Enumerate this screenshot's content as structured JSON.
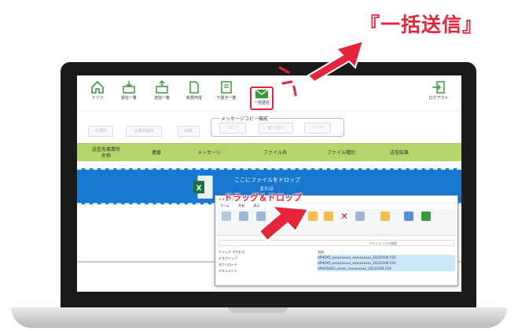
{
  "callout_title": "『一括送信』",
  "toolbar": {
    "items": [
      {
        "label": "ドリフ",
        "icon": "home-icon"
      },
      {
        "label": "受信一覧",
        "icon": "inbox-icon"
      },
      {
        "label": "送信一覧",
        "icon": "outbox-icon"
      },
      {
        "label": "新規作成",
        "icon": "new-document-icon"
      },
      {
        "label": "下書き一覧",
        "icon": "drafts-icon"
      },
      {
        "label": "一括送信",
        "icon": "bulk-send-icon"
      },
      {
        "label": "ログアウト",
        "icon": "logout-icon"
      }
    ]
  },
  "actions": {
    "select_all": "全選択",
    "deselect_all": "全選択解除",
    "delete": "削除"
  },
  "copy_group": {
    "title": "メッセージコピー機能",
    "copy": "コピー",
    "paste": "貼り付け",
    "clear": "クリア"
  },
  "table": {
    "headers": [
      "送信先事業所\n名称",
      "連番",
      "メッセージ",
      "ファイル名",
      "ファイル種別",
      "送信結果"
    ]
  },
  "dropzone": {
    "line1": "ここにファイルをドロップ",
    "line2": "または"
  },
  "drag_drop_label": "ドラッグ＆ドロップ",
  "explorer": {
    "title": "ドキュメント",
    "tabs": [
      "ホーム",
      "共有",
      "表示"
    ],
    "sidebar": [
      "クイック アクセス",
      "デスクトップ",
      "ダウンロード",
      "ドキュメント"
    ],
    "column_header": "名前",
    "files": [
      "UPHOYO_xxxxxxxxxx_xxxxxxxxxx_20210106.CSV",
      "UPHOYO_xxxxxxxxxx_xxxxxxxxxx_20210106.CSV",
      "UPHOSOKU_xxxxx_xxxxxxxxxx_20210106.CSV"
    ],
    "search_placeholder": "ドキュメントの検索"
  },
  "colors": {
    "accent_red": "#e8243b",
    "header_green": "#b3d56a",
    "drop_blue": "#1878d1"
  }
}
